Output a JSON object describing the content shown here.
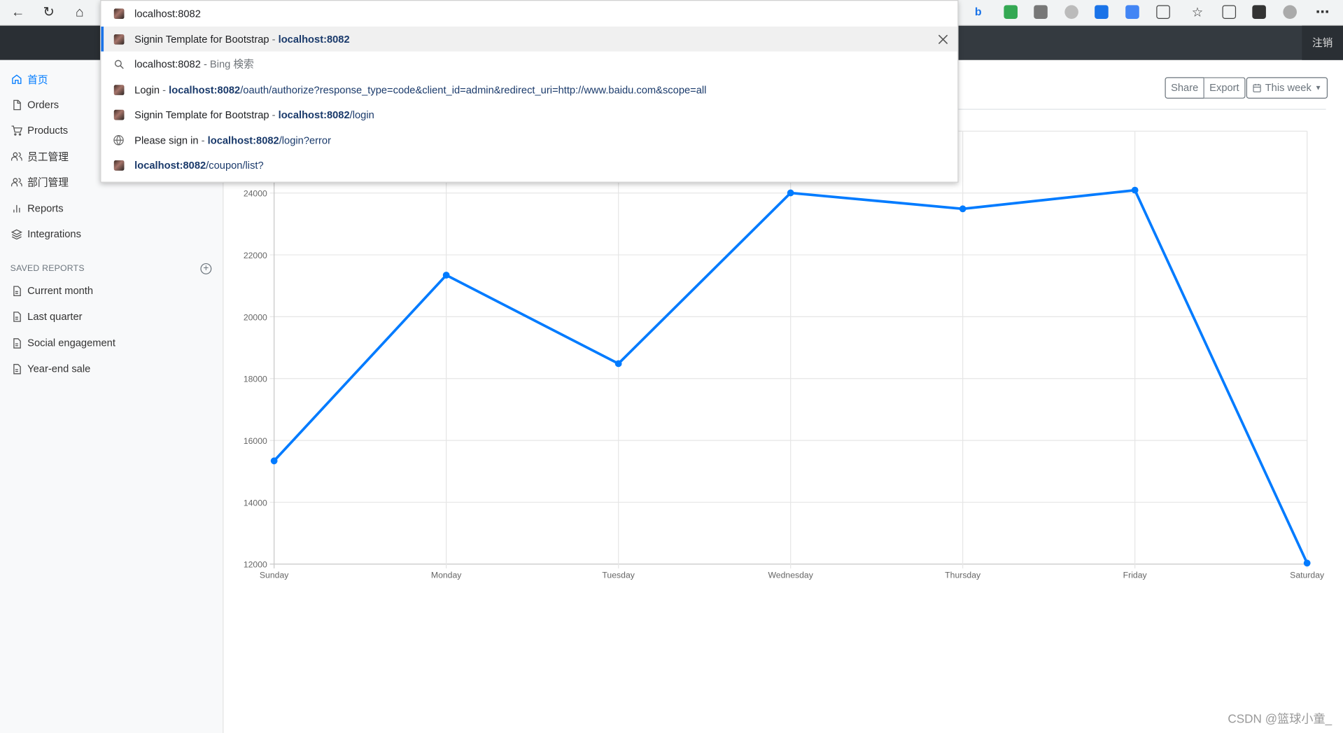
{
  "browser": {
    "address_text": "localhost:8082",
    "suggestions": [
      {
        "title": "Signin Template for Bootstrap",
        "sep": " - ",
        "host": "localhost:8082",
        "path": "",
        "icon": "site-favicon"
      },
      {
        "title": "localhost:8082",
        "sep": " - ",
        "host": "",
        "path": "",
        "extra": "Bing 検索",
        "icon": "search-icon"
      },
      {
        "title": "Login",
        "sep": " - ",
        "host": "localhost:8082",
        "path": "/oauth/authorize?response_type=code&client_id=admin&redirect_uri=http://www.baidu.com&scope=all",
        "icon": "site-favicon"
      },
      {
        "title": "Signin Template for Bootstrap",
        "sep": " - ",
        "host": "localhost:8082",
        "path": "/login",
        "icon": "site-favicon"
      },
      {
        "title": "Please sign in",
        "sep": " - ",
        "host": "localhost:8082",
        "path": "/login?error",
        "icon": "globe-icon"
      },
      {
        "title": "",
        "sep": "",
        "host": "localhost:8082",
        "path": "/coupon/list?",
        "icon": "site-favicon"
      }
    ]
  },
  "navbar": {
    "signout_label": "注销"
  },
  "sidebar": {
    "items": [
      {
        "label": "首页",
        "icon": "home-icon",
        "active": true
      },
      {
        "label": "Orders",
        "icon": "file-icon"
      },
      {
        "label": "Products",
        "icon": "cart-icon"
      },
      {
        "label": "员工管理",
        "icon": "users-icon"
      },
      {
        "label": "部门管理",
        "icon": "users-icon"
      },
      {
        "label": "Reports",
        "icon": "bar-chart-icon"
      },
      {
        "label": "Integrations",
        "icon": "layers-icon"
      }
    ],
    "saved_title": "SAVED REPORTS",
    "saved_reports": [
      "Current month",
      "Last quarter",
      "Social engagement",
      "Year-end sale"
    ]
  },
  "toolbar": {
    "share_label": "Share",
    "export_label": "Export",
    "period_label": "This week"
  },
  "chart_data": {
    "type": "line",
    "categories": [
      "Sunday",
      "Monday",
      "Tuesday",
      "Wednesday",
      "Thursday",
      "Friday",
      "Saturday"
    ],
    "values": [
      15339,
      21345,
      18483,
      24003,
      23489,
      24092,
      12034
    ],
    "ylim": [
      12000,
      26000
    ],
    "yticks": [
      12000,
      14000,
      16000,
      18000,
      20000,
      22000,
      24000
    ],
    "color": "#007bff",
    "grid": true
  },
  "watermark": "CSDN @篮球小童_"
}
